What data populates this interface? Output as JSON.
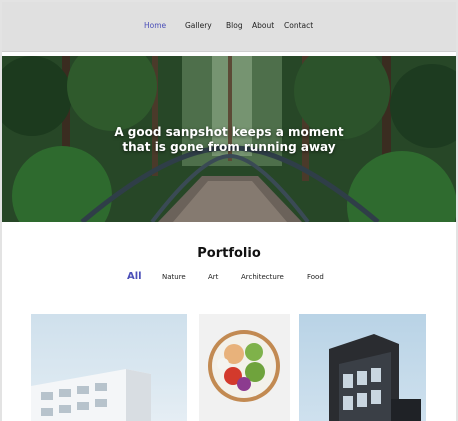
{
  "nav": {
    "items": [
      {
        "label": "Home",
        "active": true
      },
      {
        "label": "Gallery",
        "active": false
      },
      {
        "label": "Blog",
        "active": false
      },
      {
        "label": "About",
        "active": false
      },
      {
        "label": "Contact",
        "active": false
      }
    ]
  },
  "hero": {
    "line1": "A good sanpshot keeps a moment",
    "line2": "that is gone from running away"
  },
  "portfolio": {
    "title": "Portfolio",
    "filters": [
      {
        "label": "All",
        "active": true
      },
      {
        "label": "Nature",
        "active": false
      },
      {
        "label": "Art",
        "active": false
      },
      {
        "label": "Architecture",
        "active": false
      },
      {
        "label": "Food",
        "active": false
      }
    ]
  },
  "colors": {
    "accent": "#4b4fb8",
    "nav_bg": "#e0e0e0",
    "page_bg": "#ffffff"
  }
}
